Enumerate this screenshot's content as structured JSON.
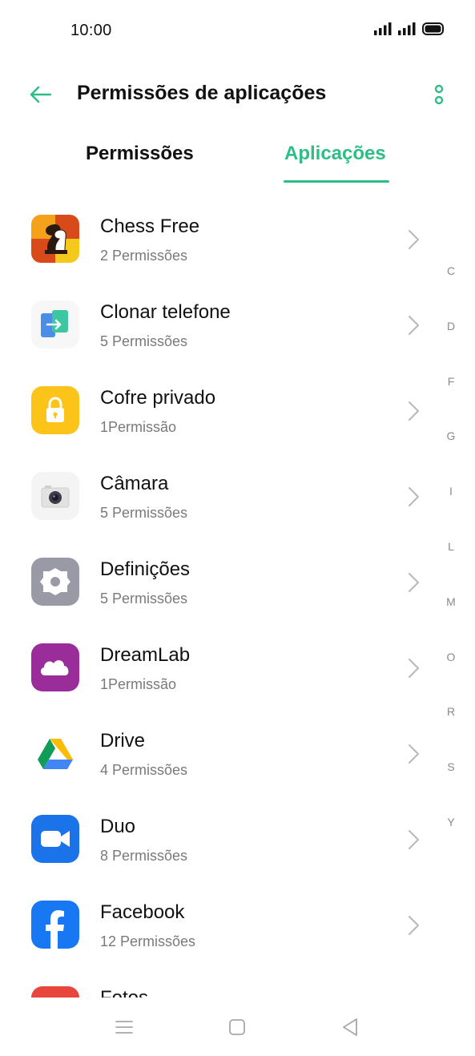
{
  "status_bar": {
    "time": "10:00",
    "icons": [
      "signal-icon",
      "signal-icon",
      "battery-icon"
    ]
  },
  "header": {
    "title": "Permissões de aplicações",
    "back_icon": "arrow-left-icon",
    "more_icon": "more-vertical-icon"
  },
  "tabs": [
    {
      "label": "Permissões",
      "active": false
    },
    {
      "label": "Aplicações",
      "active": true
    }
  ],
  "apps": [
    {
      "name": "Chess Free",
      "permissions": "2 Permissões",
      "icon": "chess-app-icon"
    },
    {
      "name": "Clonar telefone",
      "permissions": "5 Permissões",
      "icon": "clone-phone-app-icon"
    },
    {
      "name": "Cofre privado",
      "permissions": "1Permissão",
      "icon": "private-safe-app-icon"
    },
    {
      "name": "Câmara",
      "permissions": "5 Permissões",
      "icon": "camera-app-icon"
    },
    {
      "name": "Definições",
      "permissions": "5 Permissões",
      "icon": "settings-app-icon"
    },
    {
      "name": "DreamLab",
      "permissions": "1Permissão",
      "icon": "dreamlab-app-icon"
    },
    {
      "name": "Drive",
      "permissions": "4 Permissões",
      "icon": "drive-app-icon"
    },
    {
      "name": "Duo",
      "permissions": "8 Permissões",
      "icon": "duo-app-icon"
    },
    {
      "name": "Facebook",
      "permissions": "12 Permissões",
      "icon": "facebook-app-icon"
    },
    {
      "name": "Fotos",
      "permissions": "",
      "icon": "photos-app-icon"
    }
  ],
  "alpha_index": [
    "C",
    "D",
    "F",
    "G",
    "I",
    "L",
    "M",
    "O",
    "R",
    "S",
    "Y"
  ],
  "nav_bar": {
    "icons": [
      "menu-icon",
      "home-square-icon",
      "back-triangle-icon"
    ]
  },
  "colors": {
    "accent": "#2ebd85",
    "text_primary": "#111111",
    "text_secondary": "#7a7a7a"
  }
}
